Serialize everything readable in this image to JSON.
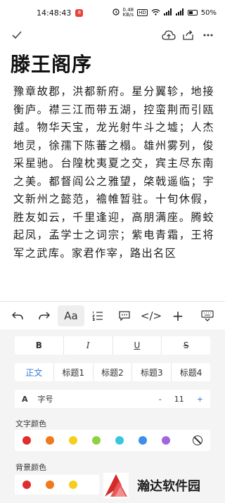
{
  "status_bar": {
    "time": "14:48:43",
    "app_badge": "8",
    "net_rate_top": "0.48",
    "net_rate_bottom": "KB/s",
    "battery": "50%",
    "battery_icon": "battery-icon",
    "wifi_icon": "wifi-icon",
    "signal_icon": "signal-icon"
  },
  "toolbar": {
    "done_icon": "checkmark-icon",
    "cloud_icon": "cloud-upload-icon",
    "share_icon": "share-icon",
    "more_icon": "more-icon"
  },
  "document": {
    "title": "滕王阁序",
    "body": "豫章故郡，洪都新府。星分翼轸，地接衡庐。襟三江而带五湖，控蛮荆而引瓯越。物华天宝，龙光射牛斗之墟；人杰地灵，徐孺下陈蕃之榻。雄州雾列，俊采星驰。台隍枕夷夏之交，宾主尽东南之美。都督阎公之雅望，棨戟遥临；宇文新州之懿范，襜帷暂驻。十旬休假，胜友如云，千里逢迎，高朋满座。腾蛟起凤，孟学士之词宗；紫电青霜，王将军之武库。家君作宰，路出名区"
  },
  "editor_toolbar": {
    "undo_icon": "undo-icon",
    "redo_icon": "redo-icon",
    "text_style_label": "Aa",
    "list_icon": "numbered-list-icon",
    "quote_icon": "comment-icon",
    "code_label": "</>",
    "add_label": "+",
    "keyboard_icon": "keyboard-hide-icon"
  },
  "format_panel": {
    "styles": [
      "B",
      "I",
      "U",
      "S"
    ],
    "headings": [
      "正文",
      "标题1",
      "标题2",
      "标题3",
      "标题4"
    ],
    "selected_heading": "正文",
    "font_size": {
      "icon_label": "A",
      "label": "字号",
      "minus": "-",
      "value": "11",
      "plus": "+"
    },
    "text_color_label": "文字颜色",
    "text_colors": [
      "#e02d2d",
      "#f07a1a",
      "#f5cf1c",
      "#8fd140",
      "#37c6dc",
      "#3b8fea",
      "#a165e0"
    ],
    "no_color_icon": "no-color-icon",
    "bg_color_label": "背景颜色",
    "bg_colors": [
      "#e02d2d",
      "#f07a1a",
      "#f5cf1c"
    ]
  },
  "accent_color": "#2f78d6",
  "watermark": {
    "text": "瀚达软件园"
  }
}
